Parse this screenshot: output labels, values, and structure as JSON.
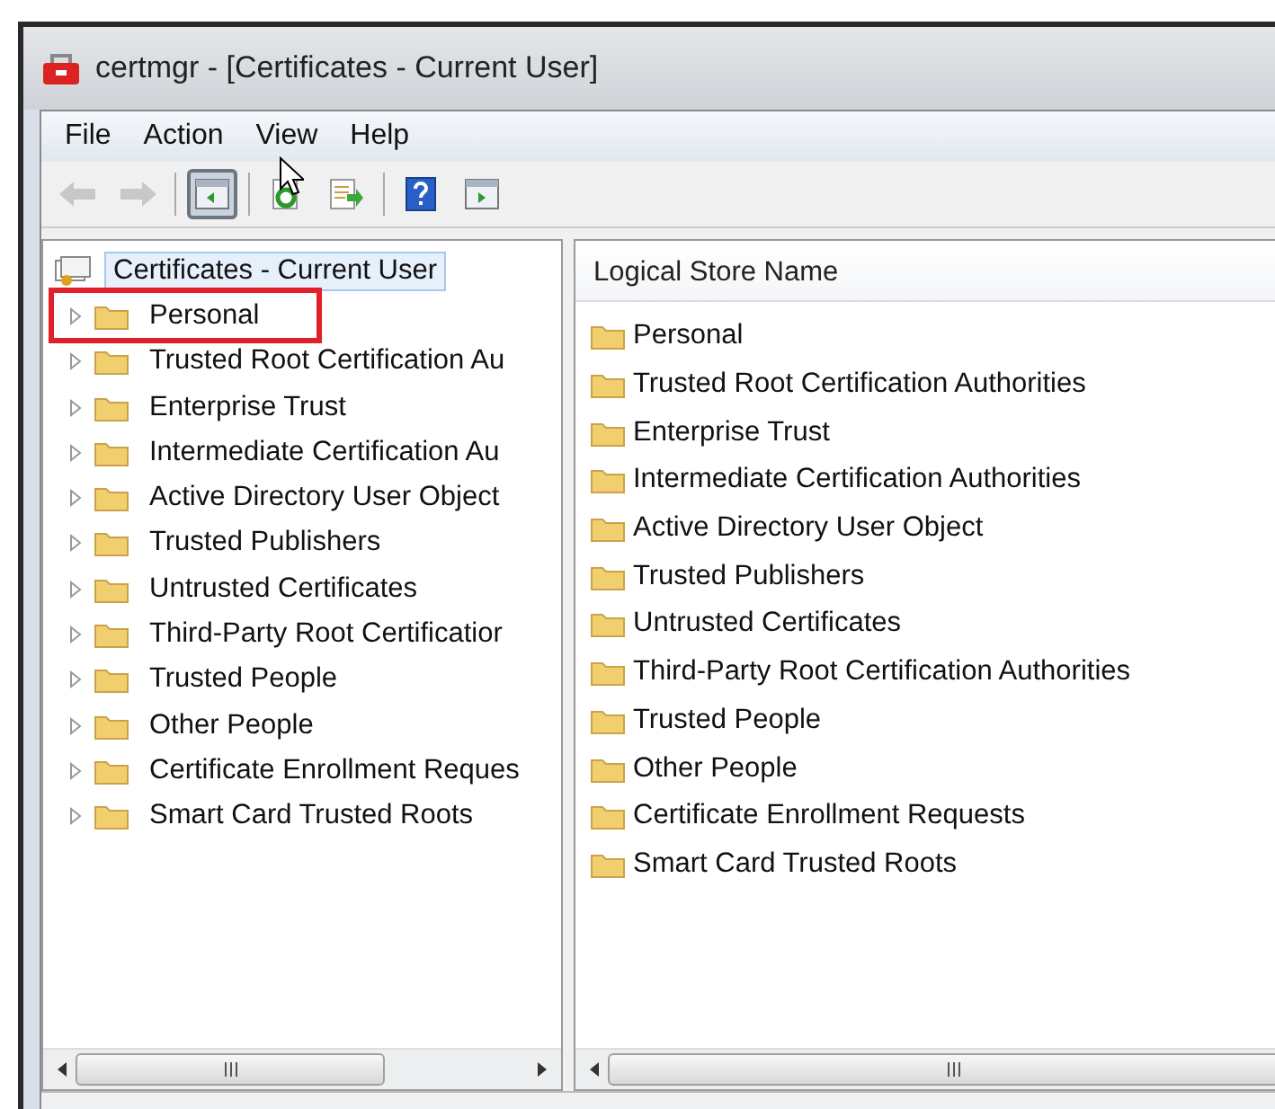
{
  "window": {
    "title": "certmgr - [Certificates - Current User]"
  },
  "menu": [
    "File",
    "Action",
    "View",
    "Help"
  ],
  "toolbar": [
    [
      {
        "kind": "back",
        "disabled": true,
        "pressed": false
      },
      {
        "kind": "forward",
        "disabled": true,
        "pressed": false
      }
    ],
    [
      {
        "kind": "console-tree",
        "disabled": false,
        "pressed": true
      }
    ],
    [
      {
        "kind": "refresh",
        "disabled": false,
        "pressed": false
      },
      {
        "kind": "export",
        "disabled": false,
        "pressed": false
      }
    ],
    [
      {
        "kind": "help",
        "disabled": false,
        "pressed": false
      },
      {
        "kind": "action-pane",
        "disabled": false,
        "pressed": false
      }
    ]
  ],
  "tree": {
    "label": "Certificates - Current User",
    "selected": true,
    "expanded": true,
    "children": [
      {
        "label": "Personal",
        "selected": false,
        "expanded": false,
        "outlined": true
      },
      {
        "label": "Trusted Root Certification Au",
        "selected": false,
        "expanded": false,
        "outlined": false
      },
      {
        "label": "Enterprise Trust",
        "selected": false,
        "expanded": false,
        "outlined": false
      },
      {
        "label": "Intermediate Certification Au",
        "selected": false,
        "expanded": false,
        "outlined": false
      },
      {
        "label": "Active Directory User Object",
        "selected": false,
        "expanded": false,
        "outlined": false
      },
      {
        "label": "Trusted Publishers",
        "selected": false,
        "expanded": false,
        "outlined": false
      },
      {
        "label": "Untrusted Certificates",
        "selected": false,
        "expanded": false,
        "outlined": false
      },
      {
        "label": "Third-Party Root Certificatior",
        "selected": false,
        "expanded": false,
        "outlined": false
      },
      {
        "label": "Trusted People",
        "selected": false,
        "expanded": false,
        "outlined": false
      },
      {
        "label": "Other People",
        "selected": false,
        "expanded": false,
        "outlined": false
      },
      {
        "label": "Certificate Enrollment Reques",
        "selected": false,
        "expanded": false,
        "outlined": false
      },
      {
        "label": "Smart Card Trusted Roots",
        "selected": false,
        "expanded": false,
        "outlined": false
      }
    ]
  },
  "list": {
    "columns": [
      "Logical Store Name"
    ],
    "rows": [
      {
        "name": "Personal",
        "selected": false
      },
      {
        "name": "Trusted Root Certification Authorities",
        "selected": false
      },
      {
        "name": "Enterprise Trust",
        "selected": false
      },
      {
        "name": "Intermediate Certification Authorities",
        "selected": false
      },
      {
        "name": "Active Directory User Object",
        "selected": false
      },
      {
        "name": "Trusted Publishers",
        "selected": false
      },
      {
        "name": "Untrusted Certificates",
        "selected": false
      },
      {
        "name": "Third-Party Root Certification Authorities",
        "selected": false
      },
      {
        "name": "Trusted People",
        "selected": false
      },
      {
        "name": "Other People",
        "selected": false
      },
      {
        "name": "Certificate Enrollment Requests",
        "selected": false
      },
      {
        "name": "Smart Card Trusted Roots",
        "selected": false
      }
    ]
  }
}
